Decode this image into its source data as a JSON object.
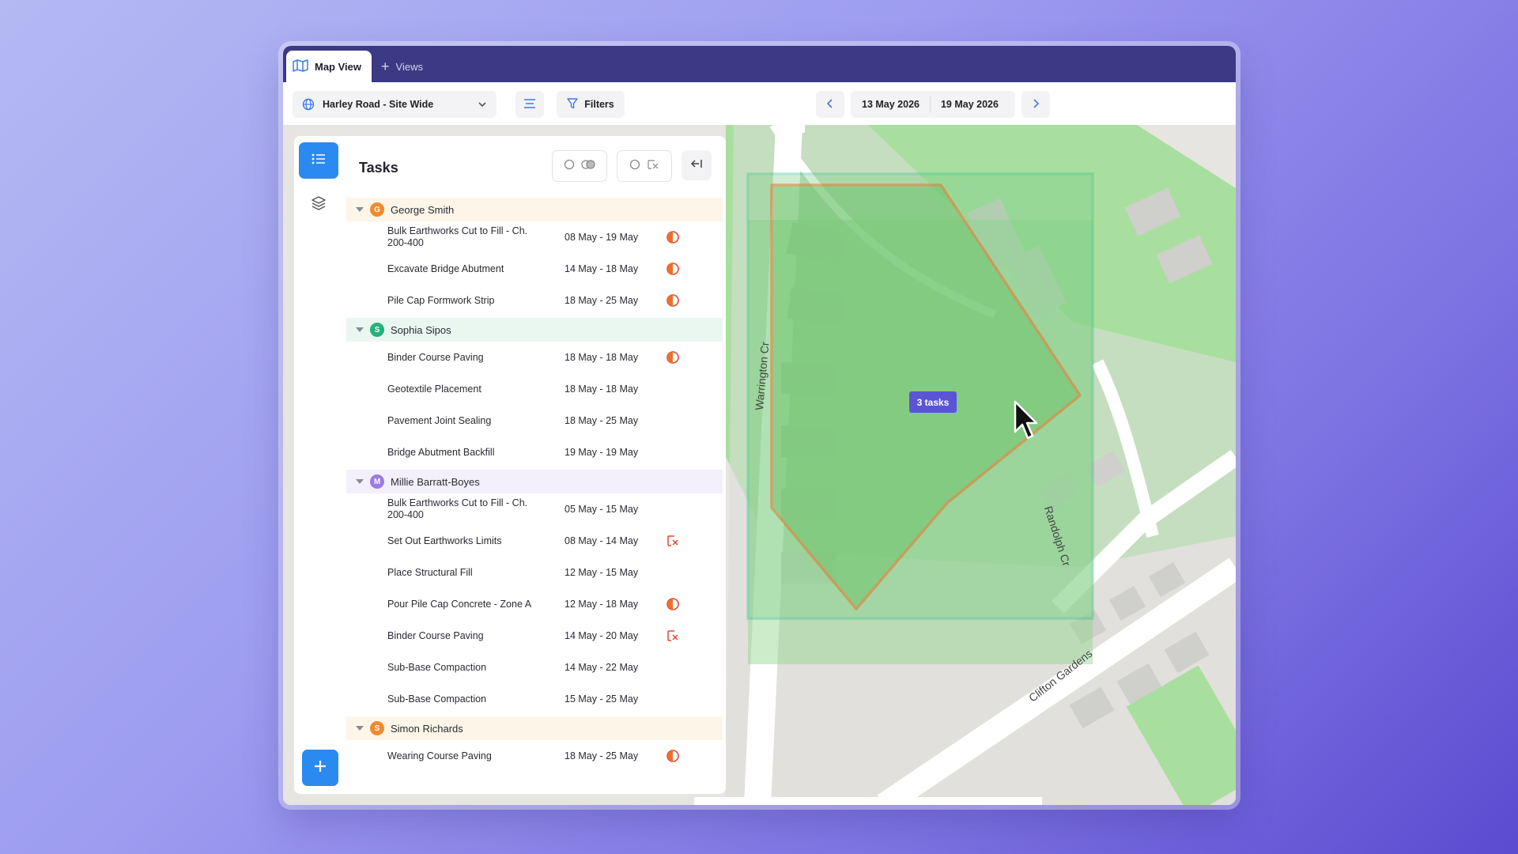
{
  "tabs": [
    {
      "label": "Map View",
      "icon": "map-icon",
      "active": true
    },
    {
      "label": "Views",
      "icon": "plus-icon",
      "active": false
    }
  ],
  "toolbar": {
    "site_selector": "Harley Road - Site Wide",
    "filters_label": "Filters",
    "date_start": "13 May 2026",
    "date_end": "19 May 2026"
  },
  "panel": {
    "title": "Tasks",
    "groups": [
      {
        "name": "George Smith",
        "initial": "G",
        "avatar_color": "#f08a2e",
        "header_bg": "#fdf6e8",
        "tasks": [
          {
            "name": "Bulk Earthworks Cut to Fill - Ch. 200-400",
            "dates": "08 May - 19 May",
            "icon": "conflict-icon"
          },
          {
            "name": "Excavate Bridge Abutment",
            "dates": "14 May - 18 May",
            "icon": "conflict-icon"
          },
          {
            "name": "Pile Cap Formwork Strip",
            "dates": "18 May - 25 May",
            "icon": "conflict-icon"
          }
        ]
      },
      {
        "name": "Sophia Sipos",
        "initial": "S",
        "avatar_color": "#27b07e",
        "header_bg": "#e9f7f0",
        "tasks": [
          {
            "name": "Binder Course Paving",
            "dates": "18 May - 18 May",
            "icon": "conflict-icon"
          },
          {
            "name": "Geotextile Placement",
            "dates": "18 May - 18 May",
            "icon": ""
          },
          {
            "name": "Pavement Joint Sealing",
            "dates": "18 May - 25 May",
            "icon": ""
          },
          {
            "name": "Bridge Abutment Backfill",
            "dates": "19 May - 19 May",
            "icon": ""
          }
        ]
      },
      {
        "name": "Millie Barratt-Boyes",
        "initial": "M",
        "avatar_color": "#9b7be6",
        "header_bg": "#f3f0fb",
        "tasks": [
          {
            "name": "Bulk Earthworks Cut to Fill - Ch. 200-400",
            "dates": "05 May - 15 May",
            "icon": ""
          },
          {
            "name": "Set Out Earthworks Limits",
            "dates": "08 May - 14 May",
            "icon": "no-location-icon"
          },
          {
            "name": "Place Structural Fill",
            "dates": "12 May - 15 May",
            "icon": ""
          },
          {
            "name": "Pour Pile Cap Concrete - Zone A",
            "dates": "12 May - 18 May",
            "icon": "conflict-icon"
          },
          {
            "name": "Binder Course Paving",
            "dates": "14 May - 20 May",
            "icon": "no-location-icon"
          },
          {
            "name": "Sub-Base Compaction",
            "dates": "14 May - 22 May",
            "icon": ""
          },
          {
            "name": "Sub-Base Compaction",
            "dates": "15 May - 25 May",
            "icon": ""
          }
        ]
      },
      {
        "name": "Simon Richards",
        "initial": "S",
        "avatar_color": "#f08a2e",
        "header_bg": "#fdf6e8",
        "tasks": [
          {
            "name": "Wearing Course Paving",
            "dates": "18 May - 25 May",
            "icon": "conflict-icon"
          }
        ]
      }
    ]
  },
  "map": {
    "street_labels": [
      "Warrington Cr",
      "Randolph Cr",
      "Clifton Gardens"
    ],
    "task_badge": "3 tasks",
    "area_outline_color": "#2fc08a",
    "polygon_color": "#e8732a"
  },
  "colors": {
    "accent": "#2a8af0",
    "tabbar": "#3c3a84",
    "badge": "#5a55d6"
  }
}
